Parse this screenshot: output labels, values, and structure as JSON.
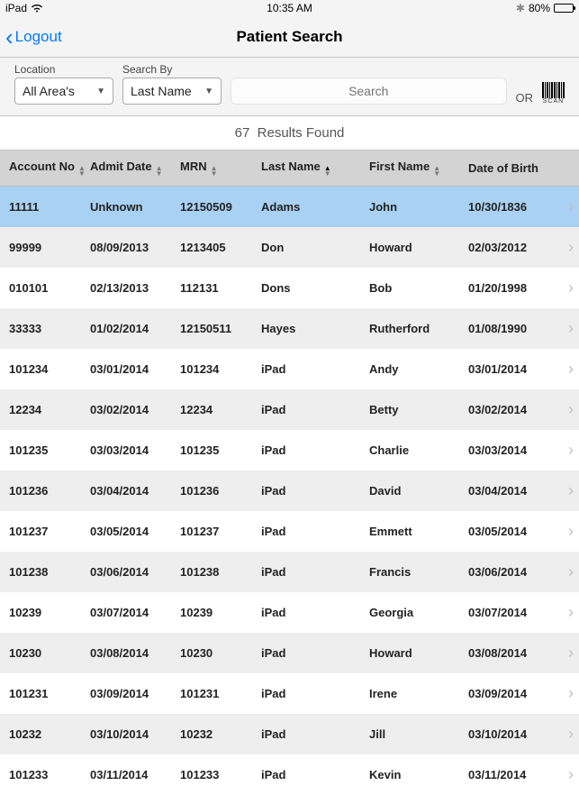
{
  "status": {
    "device": "iPad",
    "time": "10:35 AM",
    "battery_pct": "80%"
  },
  "nav": {
    "back_label": "Logout",
    "title": "Patient Search"
  },
  "filters": {
    "location_label": "Location",
    "location_value": "All Area's",
    "searchby_label": "Search By",
    "searchby_value": "Last Name",
    "search_placeholder": "Search",
    "or_label": "OR",
    "scan_label": "SCAN"
  },
  "results": {
    "count": "67",
    "suffix": "Results Found"
  },
  "columns": {
    "account": "Account No",
    "admit": "Admit Date",
    "mrn": "MRN",
    "last": "Last Name",
    "first": "First Name",
    "dob": "Date of Birth"
  },
  "rows": [
    {
      "account": "11111",
      "admit": "Unknown",
      "mrn": "12150509",
      "last": "Adams",
      "first": "John",
      "dob": "10/30/1836"
    },
    {
      "account": "99999",
      "admit": "08/09/2013",
      "mrn": "1213405",
      "last": "Don",
      "first": "Howard",
      "dob": "02/03/2012"
    },
    {
      "account": "010101",
      "admit": "02/13/2013",
      "mrn": "112131",
      "last": "Dons",
      "first": "Bob",
      "dob": "01/20/1998"
    },
    {
      "account": "33333",
      "admit": "01/02/2014",
      "mrn": "12150511",
      "last": "Hayes",
      "first": "Rutherford",
      "dob": "01/08/1990"
    },
    {
      "account": "101234",
      "admit": "03/01/2014",
      "mrn": "101234",
      "last": "iPad",
      "first": "Andy",
      "dob": "03/01/2014"
    },
    {
      "account": "12234",
      "admit": "03/02/2014",
      "mrn": "12234",
      "last": "iPad",
      "first": "Betty",
      "dob": "03/02/2014"
    },
    {
      "account": "101235",
      "admit": "03/03/2014",
      "mrn": "101235",
      "last": "iPad",
      "first": "Charlie",
      "dob": "03/03/2014"
    },
    {
      "account": "101236",
      "admit": "03/04/2014",
      "mrn": "101236",
      "last": "iPad",
      "first": "David",
      "dob": "03/04/2014"
    },
    {
      "account": "101237",
      "admit": "03/05/2014",
      "mrn": "101237",
      "last": "iPad",
      "first": "Emmett",
      "dob": "03/05/2014"
    },
    {
      "account": "101238",
      "admit": "03/06/2014",
      "mrn": "101238",
      "last": "iPad",
      "first": "Francis",
      "dob": "03/06/2014"
    },
    {
      "account": "10239",
      "admit": "03/07/2014",
      "mrn": "10239",
      "last": "iPad",
      "first": "Georgia",
      "dob": "03/07/2014"
    },
    {
      "account": "10230",
      "admit": "03/08/2014",
      "mrn": "10230",
      "last": "iPad",
      "first": "Howard",
      "dob": "03/08/2014"
    },
    {
      "account": "101231",
      "admit": "03/09/2014",
      "mrn": "101231",
      "last": "iPad",
      "first": "Irene",
      "dob": "03/09/2014"
    },
    {
      "account": "10232",
      "admit": "03/10/2014",
      "mrn": "10232",
      "last": "iPad",
      "first": "Jill",
      "dob": "03/10/2014"
    },
    {
      "account": "101233",
      "admit": "03/11/2014",
      "mrn": "101233",
      "last": "iPad",
      "first": "Kevin",
      "dob": "03/11/2014"
    }
  ],
  "selected_row_index": 0
}
